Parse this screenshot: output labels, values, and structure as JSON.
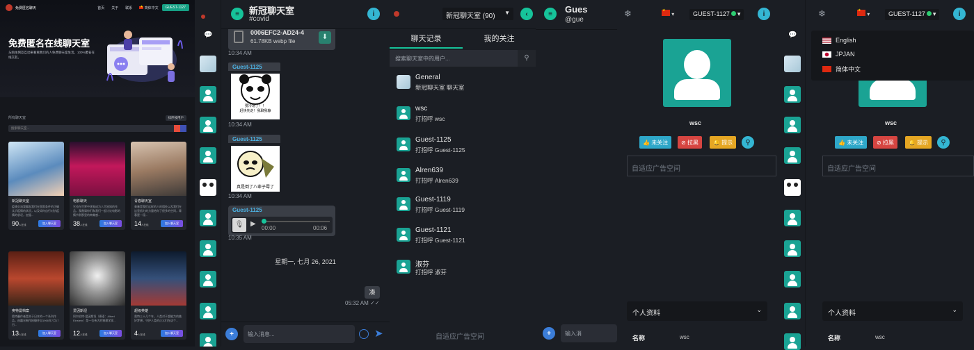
{
  "landing": {
    "brand": "免费匿名聊天",
    "nav": [
      "首页",
      "关于",
      "联系"
    ],
    "lang_label": "简体中文",
    "guest_button": "GUEST-1127",
    "hero_title": "免费匿名在线聊天室",
    "hero_desc": "与陌生网友互动来看看我们的人免费聊天室生活，100%匿名在线交友。",
    "list_head": "所有聊天室",
    "list_button": "排序按用户",
    "search_placeholder": "搜索聊天室...",
    "cards": [
      {
        "title": "新冠聊天室",
        "desc": "疫情交流我聊起我们在国家条件的正确认识疫情的状况，以及如何自行对抗疫情的状况，加强...",
        "count": "90",
        "unit": "人在线",
        "button": "加入聊天室"
      },
      {
        "title": "电影聊天",
        "desc": "它也在世界中逐渐成为人尽皆知的作品，我邀请你们和我们一起讨论电影的情节到那里的审美感...",
        "count": "38",
        "unit": "人在线",
        "button": "加入聊天室"
      },
      {
        "title": "青春聊天室",
        "desc": "青春是我们这样的人的相处以及我们在这里努力的力量给你了很多的空间，青春是一段...",
        "count": "14",
        "unit": "人在线",
        "button": "加入聊天室"
      },
      {
        "title": "奥特曼档案",
        "desc": "奥特曼作者是关于日本的一个系列作品，由圆谷制作拍摄并自1966年7月17日...",
        "count": "13",
        "unit": "人在线",
        "button": "加入聊天室"
      },
      {
        "title": "爱因斯坦",
        "desc": "阿尔伯特·爱因斯坦（德语：Albert Einstein）是一位伟大的物理学家...",
        "count": "12",
        "unit": "人在线",
        "button": "加入聊天室"
      },
      {
        "title": "超级英雄",
        "desc": "奥特三十几个年，人类对于超能力的美好梦想，守护人类的正义们在这个...",
        "count": "4",
        "unit": "人在线",
        "button": "加入聊天室"
      }
    ]
  },
  "chat": {
    "title": "新冠聊天室",
    "subtitle": "#covid",
    "file_name": "0006EFC2-AD24-4",
    "file_size": "61.78KB webp file",
    "time1": "10:34 AM",
    "sender1": "Guest-1125",
    "sticker1_text": "要冷场了！！\n赶快先走！我聊我静",
    "time2": "10:34 AM",
    "sender2": "Guest-1125",
    "sticker2_text": "真是倒了八辈子霉了",
    "time3": "10:34 AM",
    "voice_sender": "Guest-1125",
    "voice_start": "00:00",
    "voice_end": "00:06",
    "time4": "10:35 AM",
    "date_separator": "星期一, 七月 26, 2021",
    "my_message": "凑",
    "my_time": "05:32 AM",
    "input_placeholder": "输入消息..."
  },
  "rooms": {
    "selector": "新冠聊天室 (90)",
    "tab_history": "聊天记录",
    "tab_follow": "我的关注",
    "search_placeholder": "搜索聊天室中的用户...",
    "list": [
      {
        "name": "General",
        "sub": "新冠聊天室 聊天室"
      },
      {
        "name": "wsc",
        "sub": "打招呼 wsc"
      },
      {
        "name": "Guest-1125",
        "sub": "打招呼 Guest-1125"
      },
      {
        "name": "Alren639",
        "sub": "打招呼 Alren639"
      },
      {
        "name": "Guest-1119",
        "sub": "打招呼 Guest-1119"
      },
      {
        "name": "Guest-1121",
        "sub": "打招呼 Guest-1121"
      },
      {
        "name": "淑芬",
        "sub": "打招呼 淑芬"
      }
    ],
    "ad": "自适应广告空间"
  },
  "partial": {
    "title": "Gues",
    "subtitle": "@gue",
    "input_placeholder": "输入消"
  },
  "profile": {
    "guest": "GUEST-1127",
    "name": "wsc",
    "btn_unfollow": "未关注",
    "btn_block": "拉黑",
    "btn_remind": "提示",
    "ad": "自适应广告空间",
    "section": "个人资料",
    "field_label": "名称",
    "field_value": "wsc"
  },
  "languages": [
    "English",
    "JPJAN",
    "简体中文"
  ],
  "colors": {
    "accent": "#16c39a",
    "info": "#34b6d3",
    "bg": "#1b1e24"
  }
}
